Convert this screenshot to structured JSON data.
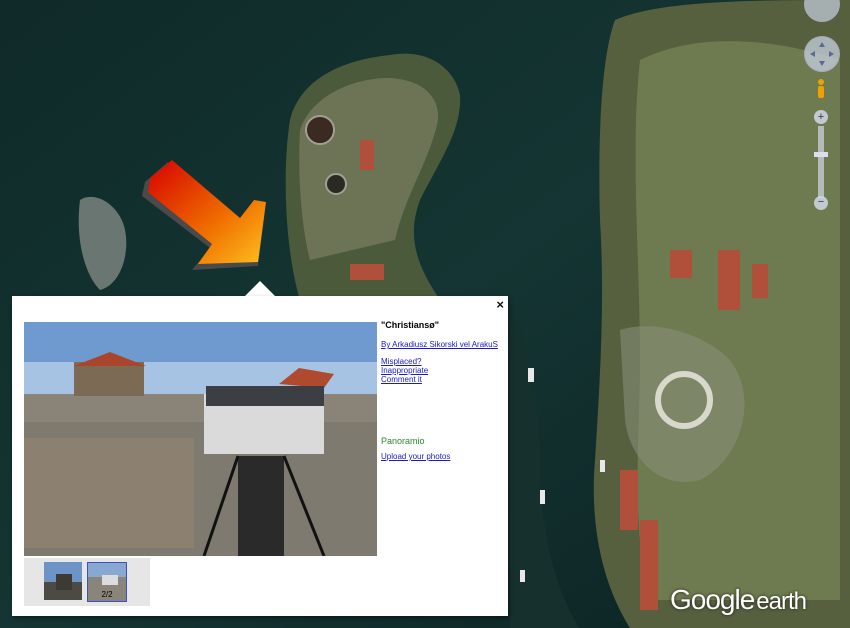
{
  "popup": {
    "title": "\"Christiansø\"",
    "author_link": "By Arkadiusz Sikorski vel ArakuS",
    "links": [
      "Misplaced?",
      "Inappropriate",
      "Comment it"
    ],
    "panoramio_logo": "Panoramio",
    "upload_link": "Upload your photos",
    "close_label": "×",
    "thumb_count": "2/2"
  },
  "map": {
    "logo_google": "Google",
    "logo_earth": "earth"
  },
  "nav_controls": {
    "zoom_in": "+",
    "zoom_out": "−"
  }
}
